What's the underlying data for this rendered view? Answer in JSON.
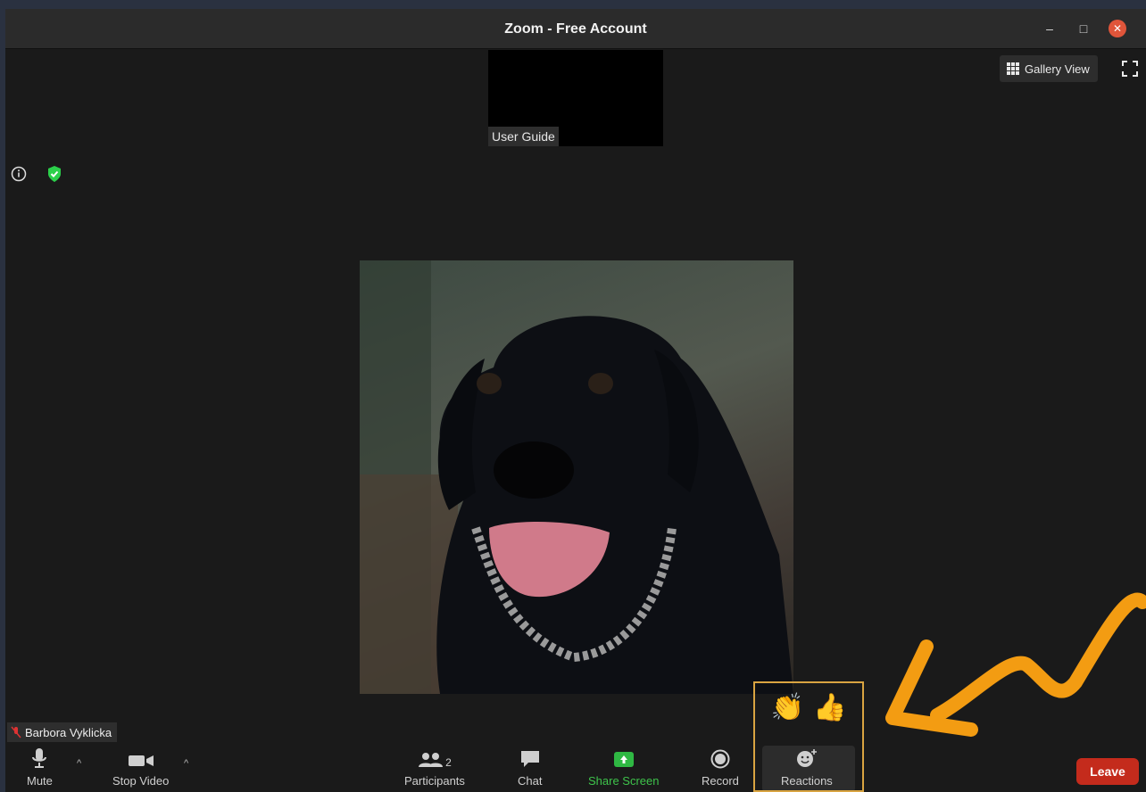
{
  "window": {
    "title": "Zoom - Free Account"
  },
  "preview": {
    "label": "User Guide"
  },
  "top_right": {
    "gallery_label": "Gallery View"
  },
  "participant": {
    "name": "Barbora Vyklicka"
  },
  "toolbar": {
    "mute_label": "Mute",
    "stop_video_label": "Stop Video",
    "participants_label": "Participants",
    "participants_count": "2",
    "chat_label": "Chat",
    "share_label": "Share Screen",
    "record_label": "Record",
    "reactions_label": "Reactions",
    "leave_label": "Leave"
  },
  "reactions": {
    "clap": "👏",
    "thumbs_up": "👍"
  },
  "colors": {
    "accent_green": "#3ec34b",
    "leave_red": "#c42b1c",
    "highlight": "#d9a441",
    "annotation_arrow": "#f39c12"
  },
  "icons": [
    "minimize-icon",
    "maximize-icon",
    "close-icon",
    "grid-icon",
    "fullscreen-icon",
    "info-icon",
    "shield-icon",
    "mic-icon",
    "video-camera-icon",
    "participants-icon",
    "chat-icon",
    "share-screen-icon",
    "record-icon",
    "reactions-icon"
  ]
}
